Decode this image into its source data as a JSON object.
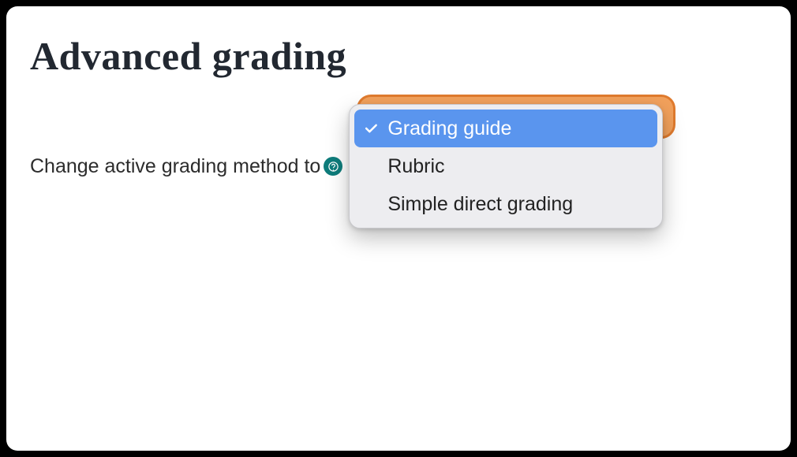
{
  "header": {
    "title": "Advanced grading"
  },
  "control": {
    "label": "Change active grading method to",
    "help_name": "help-icon",
    "selected_index": 0,
    "options": [
      {
        "label": "Grading guide"
      },
      {
        "label": "Rubric"
      },
      {
        "label": "Simple direct grading"
      }
    ]
  }
}
